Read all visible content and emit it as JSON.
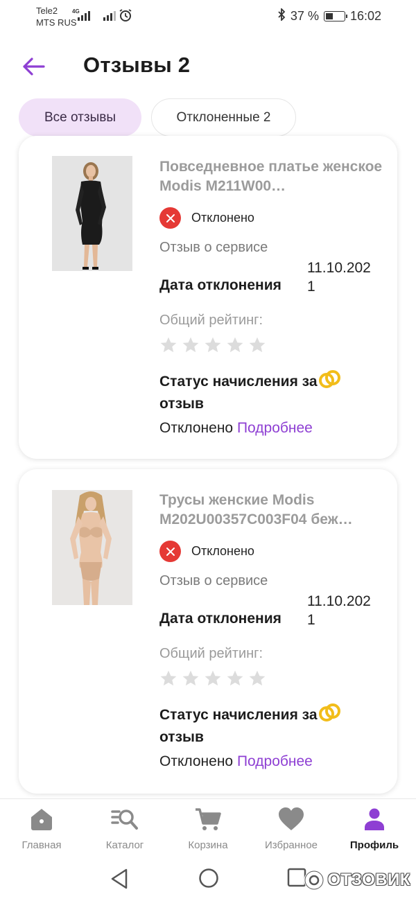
{
  "status_bar": {
    "carrier_1": "Tele2",
    "carrier_2": "MTS RUS",
    "network_badge": "4G",
    "battery": "37 %",
    "time": "16:02"
  },
  "header": {
    "title": "Отзывы 2"
  },
  "tabs": [
    {
      "label": "Все отзывы",
      "active": true
    },
    {
      "label": "Отклоненные 2",
      "active": false
    }
  ],
  "reviews": [
    {
      "product_title": "Повседневное платье женское Modis M211W00…",
      "status": "Отклонено",
      "service_label": "Отзыв о сервисе",
      "date_value": "11.10.202",
      "date_label": "Дата отклонения",
      "date_value_tail": "1",
      "rating_label": "Общий рейтинг:",
      "rating": 0,
      "accrual_label": "Статус начисления за отзыв",
      "accrual_status": "Отклонено",
      "more_link": "Подробнее"
    },
    {
      "product_title": "Трусы женские Modis M202U00357C003F04 беж…",
      "status": "Отклонено",
      "service_label": "Отзыв о сервисе",
      "date_value": "11.10.202",
      "date_label": "Дата отклонения",
      "date_value_tail": "1",
      "rating_label": "Общий рейтинг:",
      "rating": 0,
      "accrual_label": "Статус начисления за отзыв",
      "accrual_status": "Отклонено",
      "more_link": "Подробнее"
    }
  ],
  "bottom_nav": [
    {
      "label": "Главная",
      "icon": "home-icon"
    },
    {
      "label": "Каталог",
      "icon": "catalog-search-icon"
    },
    {
      "label": "Корзина",
      "icon": "cart-icon"
    },
    {
      "label": "Избранное",
      "icon": "heart-icon"
    },
    {
      "label": "Профиль",
      "icon": "profile-icon",
      "active": true
    }
  ],
  "watermark": "ОТЗОВИК",
  "colors": {
    "accent": "#8e3fd3",
    "active_tab_bg": "#f1e1f8",
    "rejected_red": "#e53935",
    "coin_gold": "#f2bd1a"
  }
}
